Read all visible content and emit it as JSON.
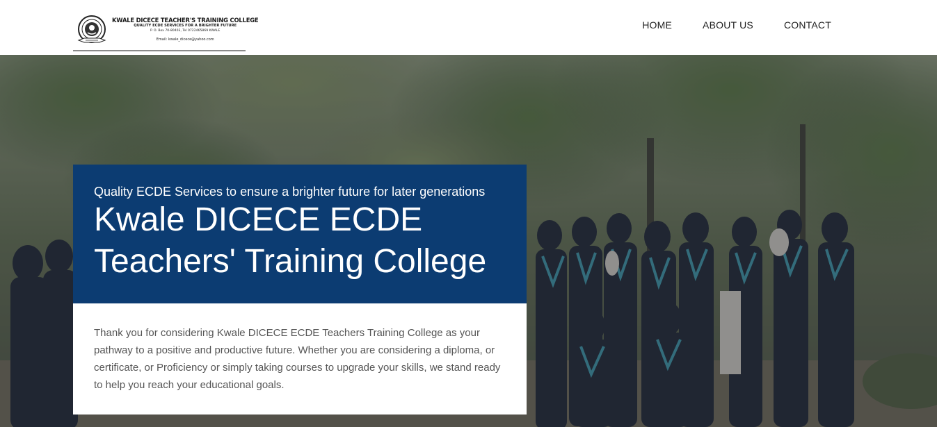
{
  "logo": {
    "name": "KWALE DICECE TEACHER'S TRAINING COLLEGE",
    "motto": "QUALITY ECDE SERVICES FOR A BRIGHTER FUTURE",
    "address": "P. O. Box 70-80403, Tel 0722465869 KWALE",
    "email": "Email: kwale_dicece@yahoo.com"
  },
  "nav": {
    "items": [
      {
        "label": "HOME"
      },
      {
        "label": "ABOUT US"
      },
      {
        "label": "CONTACT"
      }
    ]
  },
  "hero": {
    "tagline": "Quality ECDE Services to ensure a brighter future for later generations",
    "title": "Kwale DICECE ECDE Teachers' Training College",
    "text": "Thank you for considering Kwale DICECE ECDE Teachers Training College as your pathway to a positive and productive future. Whether you are considering a diploma, or certificate, or Proficiency or simply taking courses to upgrade your skills, we stand ready to help you reach your educational goals."
  },
  "colors": {
    "header_bg": "#ffffff",
    "nav_text": "#1e1e1e",
    "card_blue": "#0c3c72",
    "card_white": "#ffffff",
    "body_text": "#555555"
  }
}
